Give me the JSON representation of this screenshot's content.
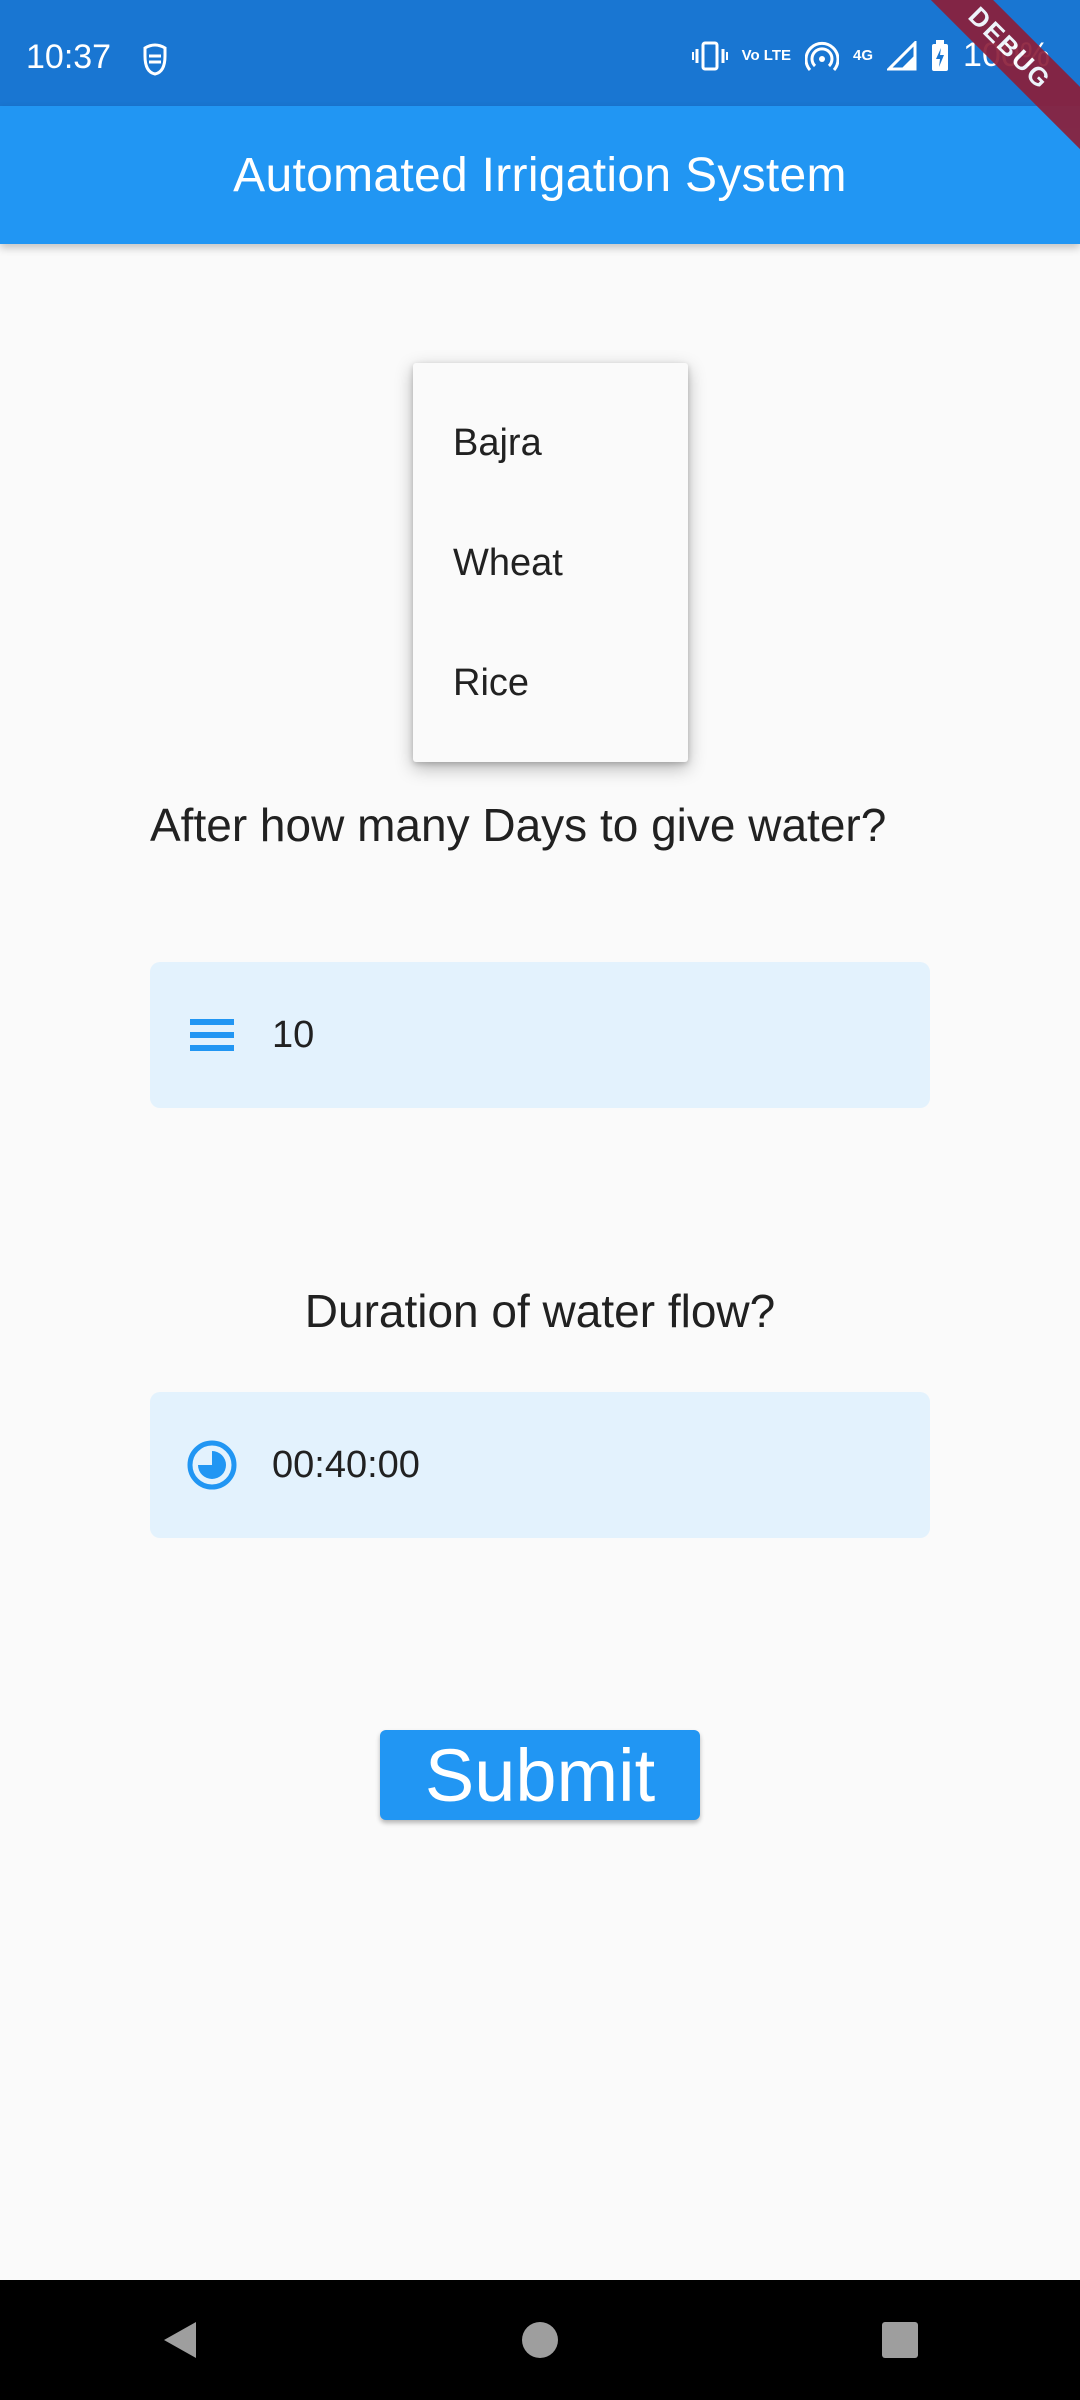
{
  "status_bar": {
    "time": "10:37",
    "battery": "100%",
    "network": "4G",
    "lte": "Vo LTE"
  },
  "debug_banner": "DEBUG",
  "app_bar": {
    "title": "Automated Irrigation System"
  },
  "crop_dropdown": {
    "options": [
      "Bajra",
      "Wheat",
      "Rice"
    ]
  },
  "days_field": {
    "label": "After how many Days to give water?",
    "value": "10",
    "icon": "reorder-icon"
  },
  "duration_field": {
    "label": "Duration of water flow?",
    "value": "00:40:00",
    "icon": "timelapse-icon"
  },
  "submit_button": {
    "label": "Submit"
  },
  "colors": {
    "status_bar": "#1976d2",
    "primary": "#2196f3",
    "input_fill": "#e3f2fd",
    "background": "#fafafa"
  }
}
